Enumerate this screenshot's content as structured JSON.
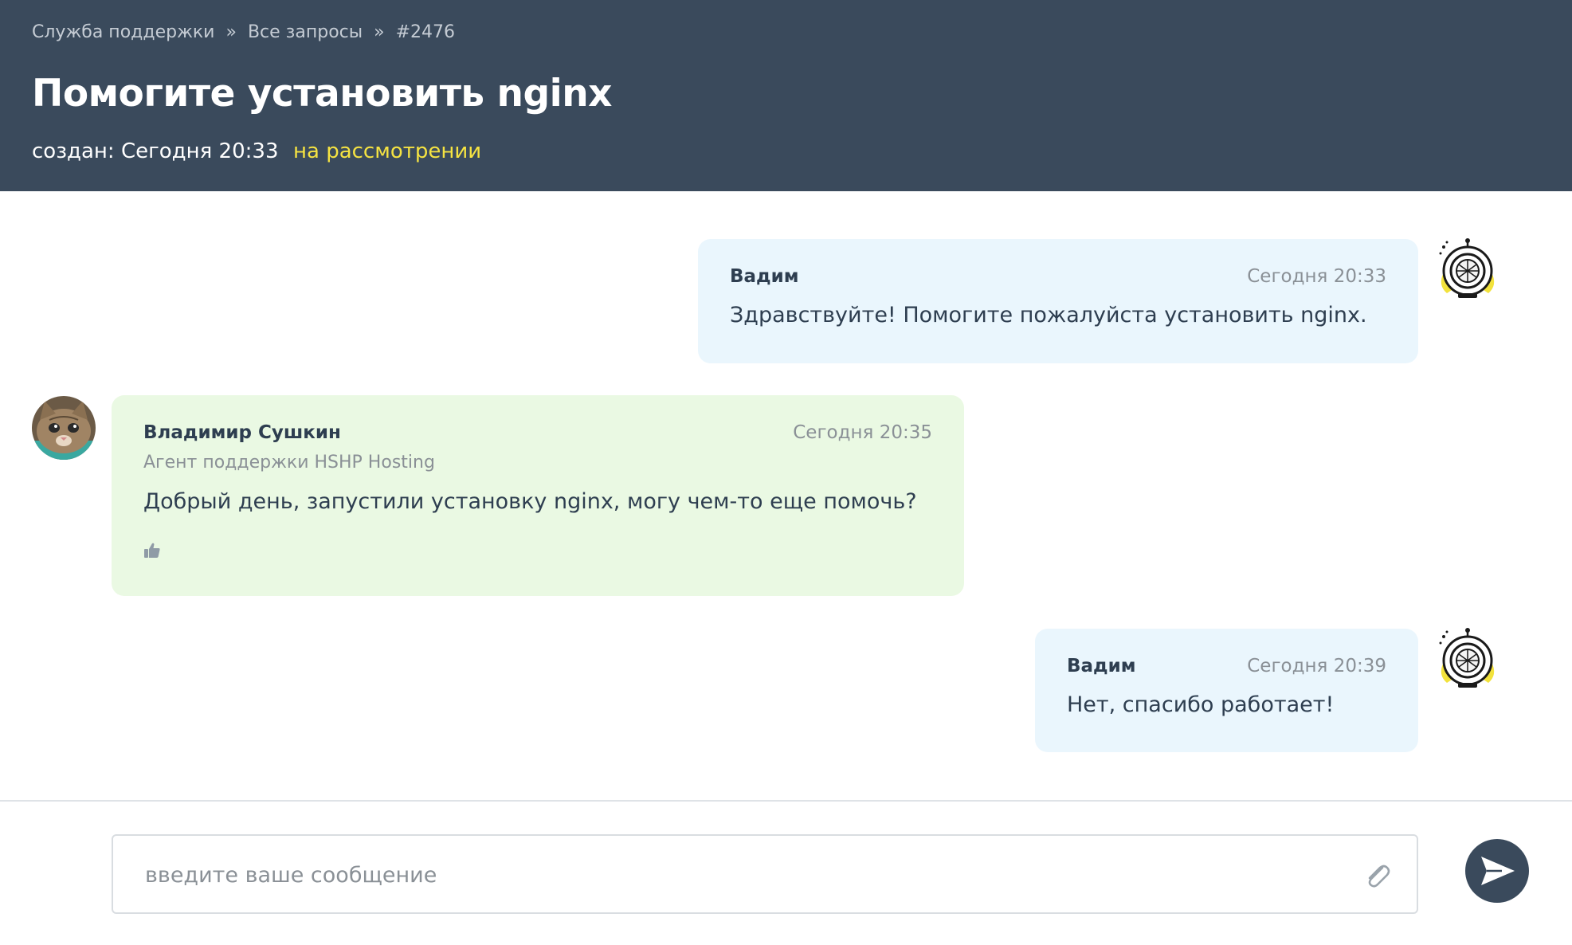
{
  "breadcrumb": {
    "items": [
      "Служба поддержки",
      "Все запросы",
      "#2476"
    ],
    "separator": "»"
  },
  "ticket": {
    "title": "Помогите установить nginx",
    "created": "создан: Сегодня 20:33",
    "status": "на рассмотрении"
  },
  "messages": [
    {
      "author": "Вадим",
      "time": "Сегодня 20:33",
      "text": "Здравствуйте! Помогите пожалуйста установить nginx."
    },
    {
      "author": "Владимир Сушкин",
      "role": "Агент поддержки HSHP Hosting",
      "time": "Сегодня 20:35",
      "text": "Добрый день, запустили установку nginx, могу чем-то еще помочь?"
    },
    {
      "author": "Вадим",
      "time": "Сегодня 20:39",
      "text": "Нет, спасибо работает!"
    }
  ],
  "composer": {
    "placeholder": "введите ваше сообщение"
  },
  "icons": {
    "attach": "paperclip-icon",
    "send": "send-icon",
    "like": "thumbs-up-icon"
  },
  "colors": {
    "header_bg": "#3a4a5c",
    "status": "#f5e342",
    "user_bubble": "#eaf6fd",
    "agent_bubble": "#eaf9e3"
  }
}
